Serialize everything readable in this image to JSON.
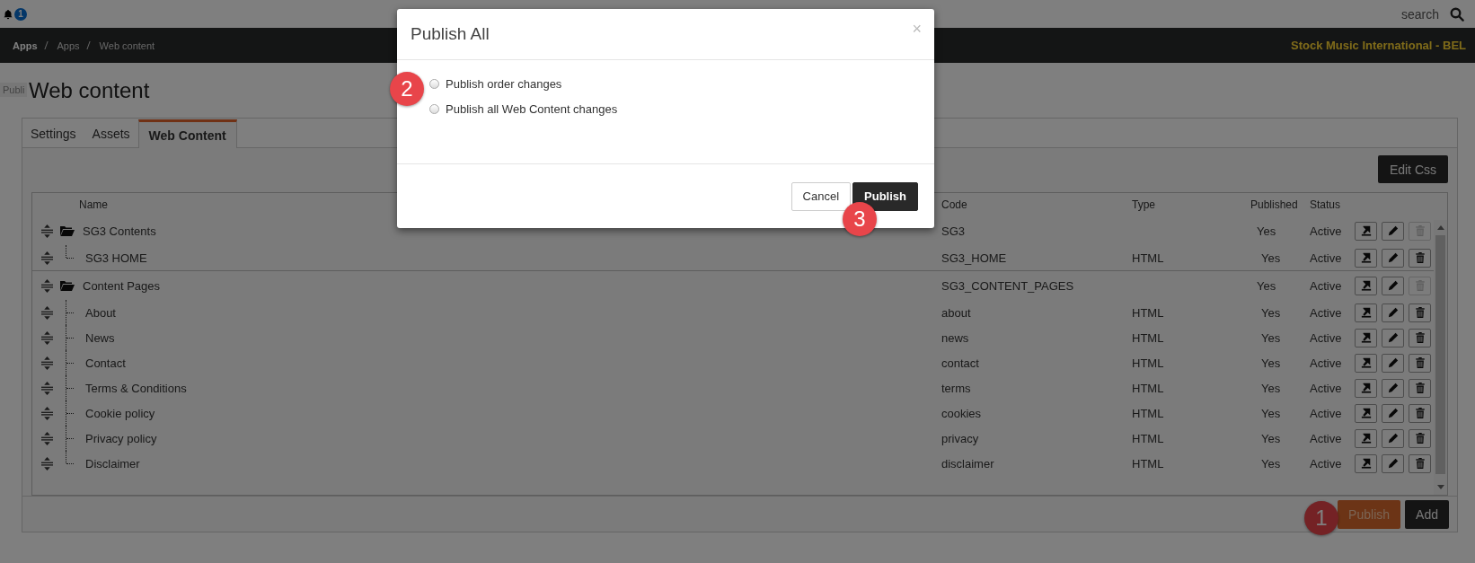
{
  "top_bar": {
    "notification_count": "1",
    "search_label": "search"
  },
  "breadcrumb": [
    "Apps",
    "Apps",
    "Web content"
  ],
  "company": "Stock Music International - BEL",
  "tooltip": "Publi",
  "page_title": "Web content",
  "tabs": [
    {
      "label": "Settings",
      "selected": false
    },
    {
      "label": "Assets",
      "selected": false
    },
    {
      "label": "Web Content",
      "selected": true
    }
  ],
  "edit_css_button": "Edit Css",
  "table": {
    "columns": [
      "Name",
      "Code",
      "Type",
      "Published",
      "Status"
    ],
    "rows": [
      {
        "kind": "folder",
        "name": "SG3 Contents",
        "code": "SG3",
        "type": "",
        "published": "Yes",
        "status": "Active",
        "delete_disabled": true,
        "children": [
          {
            "kind": "page",
            "name": "SG3 HOME",
            "code": "SG3_HOME",
            "type": "HTML",
            "published": "Yes",
            "status": "Active",
            "delete_disabled": false
          }
        ]
      },
      {
        "kind": "folder",
        "name": "Content Pages",
        "code": "SG3_CONTENT_PAGES",
        "type": "",
        "published": "Yes",
        "status": "Active",
        "delete_disabled": true,
        "children": [
          {
            "kind": "page",
            "name": "About",
            "code": "about",
            "type": "HTML",
            "published": "Yes",
            "status": "Active",
            "delete_disabled": false
          },
          {
            "kind": "page",
            "name": "News",
            "code": "news",
            "type": "HTML",
            "published": "Yes",
            "status": "Active",
            "delete_disabled": false
          },
          {
            "kind": "page",
            "name": "Contact",
            "code": "contact",
            "type": "HTML",
            "published": "Yes",
            "status": "Active",
            "delete_disabled": false
          },
          {
            "kind": "page",
            "name": "Terms & Conditions",
            "code": "terms",
            "type": "HTML",
            "published": "Yes",
            "status": "Active",
            "delete_disabled": false
          },
          {
            "kind": "page",
            "name": "Cookie policy",
            "code": "cookies",
            "type": "HTML",
            "published": "Yes",
            "status": "Active",
            "delete_disabled": false
          },
          {
            "kind": "page",
            "name": "Privacy policy",
            "code": "privacy",
            "type": "HTML",
            "published": "Yes",
            "status": "Active",
            "delete_disabled": false
          },
          {
            "kind": "page",
            "name": "Disclaimer",
            "code": "disclaimer",
            "type": "HTML",
            "published": "Yes",
            "status": "Active",
            "delete_disabled": false
          }
        ]
      }
    ]
  },
  "footer_buttons": [
    {
      "label": "Publish",
      "kind": "publish"
    },
    {
      "label": "Add",
      "kind": "add"
    }
  ],
  "modal": {
    "title": "Publish All",
    "close": "×",
    "options": [
      {
        "label": "Publish order changes",
        "checked": false
      },
      {
        "label": "Publish all Web Content changes",
        "checked": false
      }
    ],
    "buttons": [
      {
        "label": "Cancel",
        "kind": "cancel"
      },
      {
        "label": "Publish",
        "kind": "primary"
      }
    ]
  },
  "callouts": [
    "1",
    "2",
    "3"
  ]
}
